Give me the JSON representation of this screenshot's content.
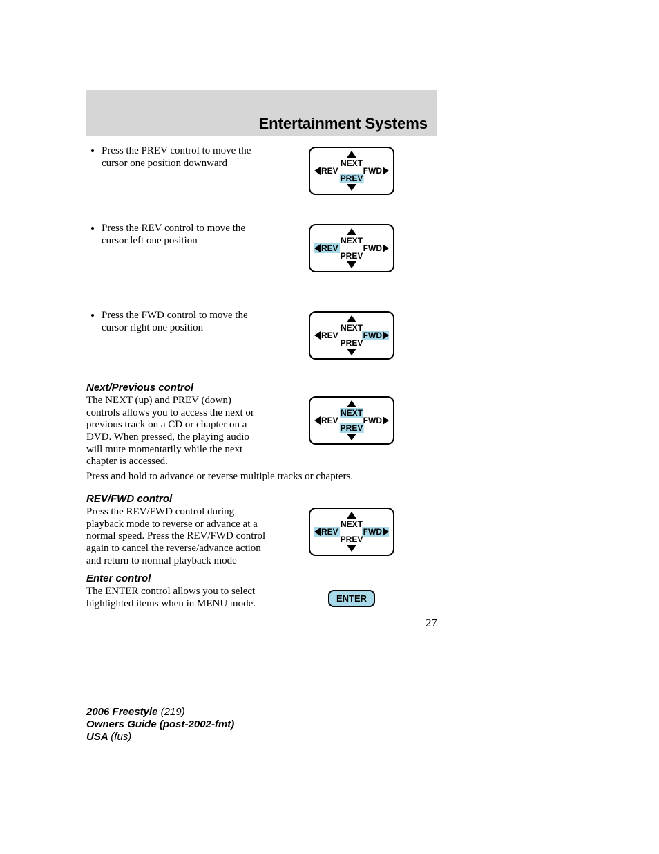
{
  "header": {
    "title": "Entertainment Systems"
  },
  "bullets": {
    "prev": "Press the PREV control to move the cursor one position downward",
    "rev": "Press the REV control to move the cursor left one position",
    "fwd": "Press the FWD control to move the cursor right one position"
  },
  "sections": {
    "nextprev": {
      "heading": "Next/Previous control",
      "body": "The NEXT (up) and PREV (down) controls allows you to access the next or previous track on a CD or chapter on a DVD. When pressed, the playing audio will mute momentarily while the next chapter is accessed.",
      "full": "Press and hold to advance or reverse multiple tracks or chapters."
    },
    "revfwd": {
      "heading": "REV/FWD control",
      "body": "Press the REV/FWD control during playback mode to reverse or advance at a normal speed. Press the REV/FWD control again to cancel the reverse/advance action and return to normal playback mode"
    },
    "enter": {
      "heading": "Enter control",
      "body": "The ENTER control allows you to select highlighted items when in MENU mode."
    }
  },
  "pad": {
    "next": "NEXT",
    "prev": "PREV",
    "rev": "REV",
    "fwd": "FWD",
    "enter": "ENTER"
  },
  "page_number": "27",
  "footer": {
    "line1a": "2006 Freestyle ",
    "line1b": "(219)",
    "line2": "Owners Guide (post-2002-fmt)",
    "line3a": "USA ",
    "line3b": "(fus)"
  }
}
